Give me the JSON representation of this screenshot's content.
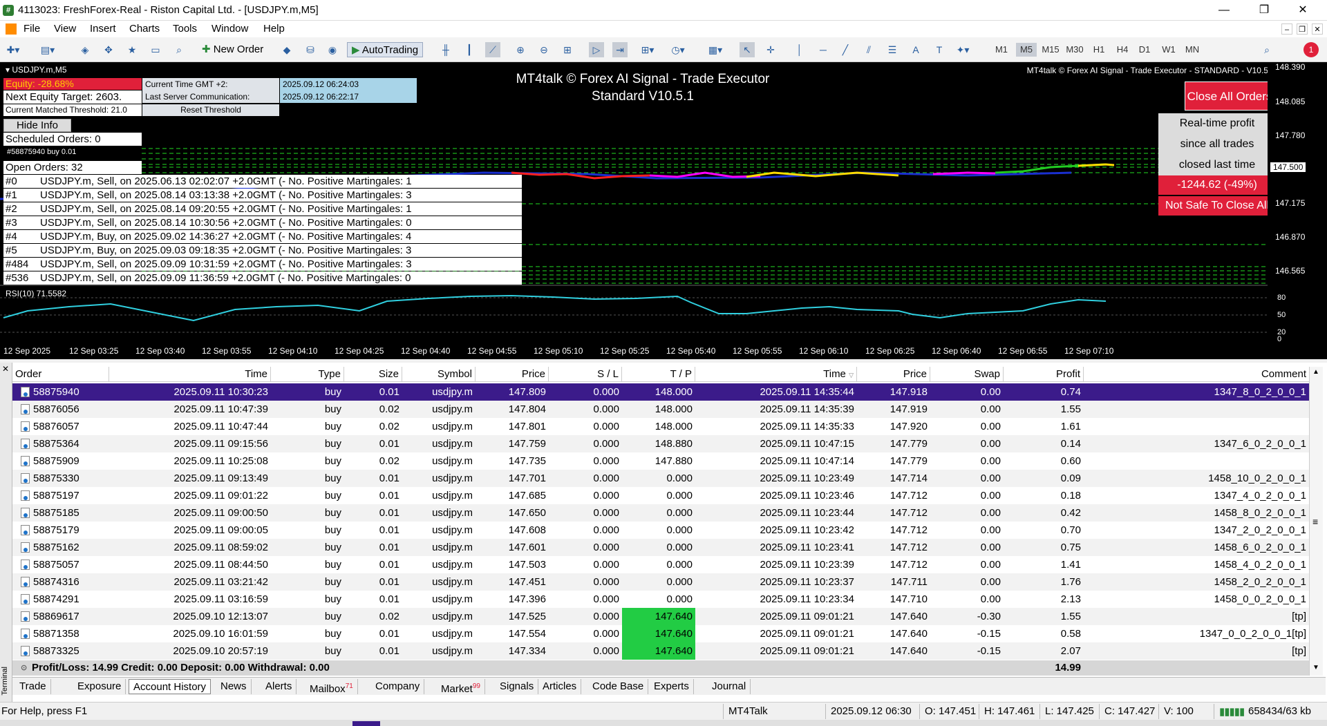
{
  "window": {
    "title": "4113023: FreshForex-Real - Riston Capital Ltd. - [USDJPY.m,M5]",
    "minimize": "—",
    "restore": "❐",
    "close": "✕"
  },
  "menu": [
    "File",
    "View",
    "Insert",
    "Charts",
    "Tools",
    "Window",
    "Help"
  ],
  "toolbar": {
    "new_order": "New Order",
    "autotrading": "AutoTrading",
    "timeframes": [
      "M1",
      "M5",
      "M15",
      "M30",
      "H1",
      "H4",
      "D1",
      "W1",
      "MN"
    ],
    "active_timeframe": "M5",
    "notification_count": "1"
  },
  "chart": {
    "symbol": "USDJPY.m,M5",
    "equity": "Equity: -28.68%",
    "next_equity": "Next Equity Target: 2603.",
    "threshold": "Current Matched Threshold: 21.0",
    "current_time_label": "Current Time GMT +2:",
    "current_time_value": "2025.09.12 06:24:03",
    "server_comm_label": "Last Server Communication:",
    "server_comm_value": "2025.09.12 06:22:17",
    "reset_threshold": "Reset Threshold",
    "hide_info": "Hide Info",
    "scheduled": "Scheduled Orders: 0",
    "buy_label": "#58875940 buy 0.01",
    "open_orders": "Open Orders: 32",
    "orders": [
      {
        "idx": "#0",
        "text": "USDJPY.m, Sell, on 2025.06.13 02:02:07 +2.0GMT  (- No. Positive Martingales: 1"
      },
      {
        "idx": "#1",
        "text": "USDJPY.m, Sell, on 2025.08.14 03:13:38 +2.0GMT  (- No. Positive Martingales: 3"
      },
      {
        "idx": "#2",
        "text": "USDJPY.m, Sell, on 2025.08.14 09:20:55 +2.0GMT  (- No. Positive Martingales: 1"
      },
      {
        "idx": "#3",
        "text": "USDJPY.m, Sell, on 2025.08.14 10:30:56 +2.0GMT  (- No. Positive Martingales: 0"
      },
      {
        "idx": "#4",
        "text": "USDJPY.m, Buy, on 2025.09.02 14:36:27 +2.0GMT  (- No. Positive Martingales: 4"
      },
      {
        "idx": "#5",
        "text": "USDJPY.m, Buy, on 2025.09.03 09:18:35 +2.0GMT  (- No. Positive Martingales: 3"
      },
      {
        "idx": "#484",
        "text": "USDJPY.m, Sell, on 2025.09.09 10:31:59 +2.0GMT  (- No. Positive Martingales: 3"
      },
      {
        "idx": "#536",
        "text": "USDJPY.m, Sell, on 2025.09.09 11:36:59 +2.0GMT  (- No. Positive Martingales: 0"
      }
    ],
    "headline_1": "MT4talk © Forex AI Signal - Trade Executor",
    "headline_2": "Standard V10.5.1",
    "top_right_label": "MT4talk © Forex AI Signal - Trade Executor - STANDARD - V10.5.1",
    "close_all": "Close All Orders",
    "rtp_1": "Real-time profit",
    "rtp_2": "since all trades",
    "rtp_3": "closed last time",
    "rtp_value": "-1244.62 (-49%)",
    "not_safe": "Not Safe To Close All",
    "prices": [
      "148.390",
      "148.085",
      "147.780",
      "147.500",
      "147.175",
      "146.870",
      "146.565"
    ],
    "rsi_label": "RSI(10) 71.5582",
    "rsi_levels": [
      "80",
      "50",
      "20",
      "0"
    ],
    "times": [
      "12 Sep 2025",
      "12 Sep 03:25",
      "12 Sep 03:40",
      "12 Sep 03:55",
      "12 Sep 04:10",
      "12 Sep 04:25",
      "12 Sep 04:40",
      "12 Sep 04:55",
      "12 Sep 05:10",
      "12 Sep 05:25",
      "12 Sep 05:40",
      "12 Sep 05:55",
      "12 Sep 06:10",
      "12 Sep 06:25",
      "12 Sep 06:40",
      "12 Sep 06:55",
      "12 Sep 07:10"
    ]
  },
  "table": {
    "headers": [
      "Order",
      "Time",
      "Type",
      "Size",
      "Symbol",
      "Price",
      "S / L",
      "T / P",
      "Time",
      "Price",
      "Swap",
      "Profit",
      "Comment"
    ],
    "rows": [
      [
        "58875940",
        "2025.09.11 10:30:23",
        "buy",
        "0.01",
        "usdjpy.m",
        "147.809",
        "0.000",
        "148.000",
        "2025.09.11 14:35:44",
        "147.918",
        "0.00",
        "0.74",
        "1347_8_0_2_0_0_1"
      ],
      [
        "58876056",
        "2025.09.11 10:47:39",
        "buy",
        "0.02",
        "usdjpy.m",
        "147.804",
        "0.000",
        "148.000",
        "2025.09.11 14:35:39",
        "147.919",
        "0.00",
        "1.55",
        ""
      ],
      [
        "58876057",
        "2025.09.11 10:47:44",
        "buy",
        "0.02",
        "usdjpy.m",
        "147.801",
        "0.000",
        "148.000",
        "2025.09.11 14:35:33",
        "147.920",
        "0.00",
        "1.61",
        ""
      ],
      [
        "58875364",
        "2025.09.11 09:15:56",
        "buy",
        "0.01",
        "usdjpy.m",
        "147.759",
        "0.000",
        "148.880",
        "2025.09.11 10:47:15",
        "147.779",
        "0.00",
        "0.14",
        "1347_6_0_2_0_0_1"
      ],
      [
        "58875909",
        "2025.09.11 10:25:08",
        "buy",
        "0.02",
        "usdjpy.m",
        "147.735",
        "0.000",
        "147.880",
        "2025.09.11 10:47:14",
        "147.779",
        "0.00",
        "0.60",
        ""
      ],
      [
        "58875330",
        "2025.09.11 09:13:49",
        "buy",
        "0.01",
        "usdjpy.m",
        "147.701",
        "0.000",
        "0.000",
        "2025.09.11 10:23:49",
        "147.714",
        "0.00",
        "0.09",
        "1458_10_0_2_0_0_1"
      ],
      [
        "58875197",
        "2025.09.11 09:01:22",
        "buy",
        "0.01",
        "usdjpy.m",
        "147.685",
        "0.000",
        "0.000",
        "2025.09.11 10:23:46",
        "147.712",
        "0.00",
        "0.18",
        "1347_4_0_2_0_0_1"
      ],
      [
        "58875185",
        "2025.09.11 09:00:50",
        "buy",
        "0.01",
        "usdjpy.m",
        "147.650",
        "0.000",
        "0.000",
        "2025.09.11 10:23:44",
        "147.712",
        "0.00",
        "0.42",
        "1458_8_0_2_0_0_1"
      ],
      [
        "58875179",
        "2025.09.11 09:00:05",
        "buy",
        "0.01",
        "usdjpy.m",
        "147.608",
        "0.000",
        "0.000",
        "2025.09.11 10:23:42",
        "147.712",
        "0.00",
        "0.70",
        "1347_2_0_2_0_0_1"
      ],
      [
        "58875162",
        "2025.09.11 08:59:02",
        "buy",
        "0.01",
        "usdjpy.m",
        "147.601",
        "0.000",
        "0.000",
        "2025.09.11 10:23:41",
        "147.712",
        "0.00",
        "0.75",
        "1458_6_0_2_0_0_1"
      ],
      [
        "58875057",
        "2025.09.11 08:44:50",
        "buy",
        "0.01",
        "usdjpy.m",
        "147.503",
        "0.000",
        "0.000",
        "2025.09.11 10:23:39",
        "147.712",
        "0.00",
        "1.41",
        "1458_4_0_2_0_0_1"
      ],
      [
        "58874316",
        "2025.09.11 03:21:42",
        "buy",
        "0.01",
        "usdjpy.m",
        "147.451",
        "0.000",
        "0.000",
        "2025.09.11 10:23:37",
        "147.711",
        "0.00",
        "1.76",
        "1458_2_0_2_0_0_1"
      ],
      [
        "58874291",
        "2025.09.11 03:16:59",
        "buy",
        "0.01",
        "usdjpy.m",
        "147.396",
        "0.000",
        "0.000",
        "2025.09.11 10:23:34",
        "147.710",
        "0.00",
        "2.13",
        "1458_0_0_2_0_0_1"
      ],
      [
        "58869617",
        "2025.09.10 12:13:07",
        "buy",
        "0.02",
        "usdjpy.m",
        "147.525",
        "0.000",
        "147.640",
        "2025.09.11 09:01:21",
        "147.640",
        "-0.30",
        "1.55",
        "[tp]"
      ],
      [
        "58871358",
        "2025.09.10 16:01:59",
        "buy",
        "0.01",
        "usdjpy.m",
        "147.554",
        "0.000",
        "147.640",
        "2025.09.11 09:01:21",
        "147.640",
        "-0.15",
        "0.58",
        "1347_0_0_2_0_0_1[tp]"
      ],
      [
        "58873325",
        "2025.09.10 20:57:19",
        "buy",
        "0.01",
        "usdjpy.m",
        "147.334",
        "0.000",
        "147.640",
        "2025.09.11 09:01:21",
        "147.640",
        "-0.15",
        "2.07",
        "[tp]"
      ]
    ],
    "totals": {
      "summary": "Profit/Loss: 14.99  Credit: 0.00  Deposit: 0.00  Withdrawal: 0.00",
      "profit": "14.99"
    }
  },
  "tabs": [
    {
      "label": "Trade",
      "badge": ""
    },
    {
      "label": "Exposure",
      "badge": ""
    },
    {
      "label": "Account History",
      "badge": ""
    },
    {
      "label": "News",
      "badge": ""
    },
    {
      "label": "Alerts",
      "badge": ""
    },
    {
      "label": "Mailbox",
      "badge": "71"
    },
    {
      "label": "Company",
      "badge": ""
    },
    {
      "label": "Market",
      "badge": "99"
    },
    {
      "label": "Signals",
      "badge": ""
    },
    {
      "label": "Articles",
      "badge": ""
    },
    {
      "label": "Code Base",
      "badge": ""
    },
    {
      "label": "Experts",
      "badge": ""
    },
    {
      "label": "Journal",
      "badge": ""
    }
  ],
  "terminal_label": "Terminal",
  "status": {
    "help": "For Help, press F1",
    "profile": "MT4Talk",
    "datetime": "2025.09.12 06:30",
    "open": "O: 147.451",
    "high": "H: 147.461",
    "low": "L: 147.425",
    "close": "C: 147.427",
    "volume": "V: 100",
    "traffic": "658434/63 kb"
  }
}
